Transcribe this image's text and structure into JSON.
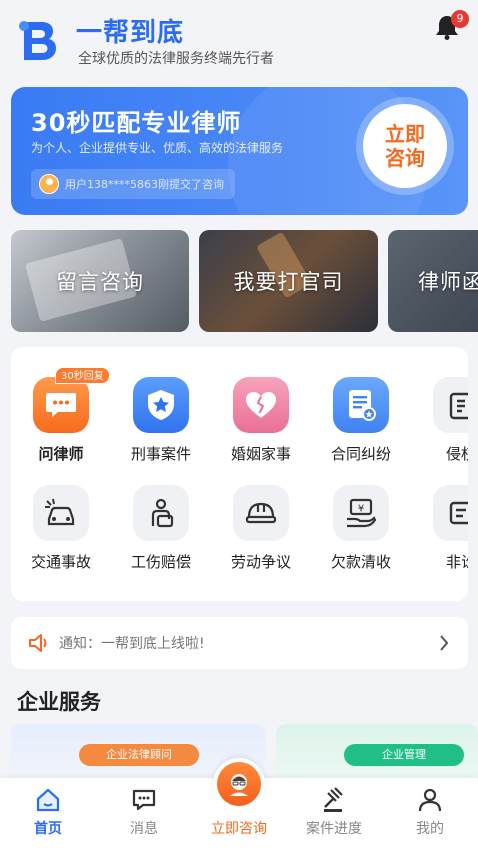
{
  "header": {
    "brand_name": "一帮到底",
    "tagline": "全球优质的法律服务终端先行者",
    "notification_count": "9"
  },
  "hero": {
    "title": "30秒匹配专业律师",
    "subtitle": "为个人、企业提供专业、优质、高效的法律服务",
    "recent_text": "用户138****5863刚提交了咨询",
    "cta_label": "立即咨询"
  },
  "service_cards": [
    {
      "label": "留言咨询"
    },
    {
      "label": "我要打官司"
    },
    {
      "label": "律师函"
    }
  ],
  "categories": [
    {
      "label": "问律师",
      "icon": "chat-bubble-icon",
      "badge": "30秒回复"
    },
    {
      "label": "刑事案件",
      "icon": "police-badge-icon"
    },
    {
      "label": "婚姻家事",
      "icon": "broken-heart-icon"
    },
    {
      "label": "合同纠纷",
      "icon": "contract-document-icon"
    },
    {
      "label": "侵权",
      "icon": "infringement-icon"
    },
    {
      "label": "交通事故",
      "icon": "car-crash-icon"
    },
    {
      "label": "工伤赔偿",
      "icon": "injured-arm-icon"
    },
    {
      "label": "劳动争议",
      "icon": "hard-hat-icon"
    },
    {
      "label": "欠款清收",
      "icon": "money-hand-icon"
    },
    {
      "label": "非讼",
      "icon": "non-litigation-icon"
    }
  ],
  "notice": {
    "text": "通知：一帮到底上线啦!"
  },
  "enterprise": {
    "title": "企业服务",
    "cards": [
      {
        "label": "企业法律顾问"
      },
      {
        "label": "企业管理"
      }
    ]
  },
  "tabbar": {
    "tabs": [
      {
        "label": "首页",
        "icon": "home-icon"
      },
      {
        "label": "消息",
        "icon": "message-icon"
      },
      {
        "label": "立即咨询",
        "icon": "consult-avatar-icon"
      },
      {
        "label": "案件进度",
        "icon": "gavel-icon"
      },
      {
        "label": "我的",
        "icon": "profile-icon"
      }
    ]
  },
  "colors": {
    "brand_blue": "#2b6cf0",
    "accent_orange": "#f26a21",
    "badge_red": "#e53935",
    "background": "#f3f4f7"
  }
}
